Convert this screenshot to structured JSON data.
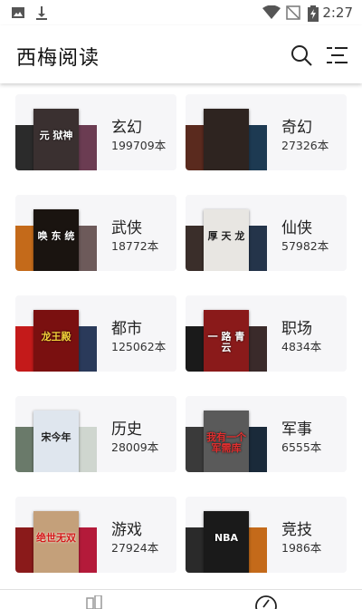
{
  "status_bar": {
    "time": "2:27",
    "icons": [
      "image-icon",
      "download-icon",
      "wifi-icon",
      "no-signal-icon",
      "battery-charging-icon"
    ]
  },
  "app_bar": {
    "title": "西梅阅读",
    "actions": [
      "search-icon",
      "menu-list-icon"
    ]
  },
  "categories": [
    {
      "name": "玄幻",
      "count": "199709本",
      "covers": {
        "left": "#2b2b2b",
        "mid": "#3a3030",
        "right": "#6b3c52",
        "mid_text": "元\n狱神"
      }
    },
    {
      "name": "奇幻",
      "count": "27326本",
      "covers": {
        "left": "#5a2a1e",
        "mid": "#2e2420",
        "right": "#1d3a52",
        "mid_text": ""
      }
    },
    {
      "name": "武侠",
      "count": "18772本",
      "covers": {
        "left": "#c46a1a",
        "mid": "#1a1410",
        "right": "#6d5a5a",
        "mid_text": "唤 东 统"
      }
    },
    {
      "name": "仙侠",
      "count": "57982本",
      "covers": {
        "left": "#3a2e2a",
        "mid": "#e8e6e2",
        "right": "#24344a",
        "mid_text": "厚 天 龙"
      }
    },
    {
      "name": "都市",
      "count": "125062本",
      "covers": {
        "left": "#c41a1a",
        "mid": "#7a1010",
        "right": "#2a3a5a",
        "mid_text": "龙王殿"
      }
    },
    {
      "name": "职场",
      "count": "4834本",
      "covers": {
        "left": "#1a1a1a",
        "mid": "#8a1a1a",
        "right": "#3a2a2a",
        "mid_text": "一 路 青 云"
      }
    },
    {
      "name": "历史",
      "count": "28009本",
      "covers": {
        "left": "#6a7a6a",
        "mid": "#dfe6ee",
        "right": "#cfd6cf",
        "mid_text": "宋今年"
      }
    },
    {
      "name": "军事",
      "count": "6555本",
      "covers": {
        "left": "#3a3a3a",
        "mid": "#5a5a5a",
        "right": "#1a2a3a",
        "mid_text": "我有一个军需库"
      }
    },
    {
      "name": "游戏",
      "count": "27924本",
      "covers": {
        "left": "#8a1a1a",
        "mid": "#c4a07a",
        "right": "#b41a3a",
        "mid_text": "绝世无双"
      }
    },
    {
      "name": "竞技",
      "count": "1986本",
      "covers": {
        "left": "#2a2a2a",
        "mid": "#1a1a1a",
        "right": "#c46a1a",
        "mid_text": "NBA"
      }
    }
  ],
  "bottom_nav": [
    "bookshelf-icon",
    "discover-icon"
  ]
}
